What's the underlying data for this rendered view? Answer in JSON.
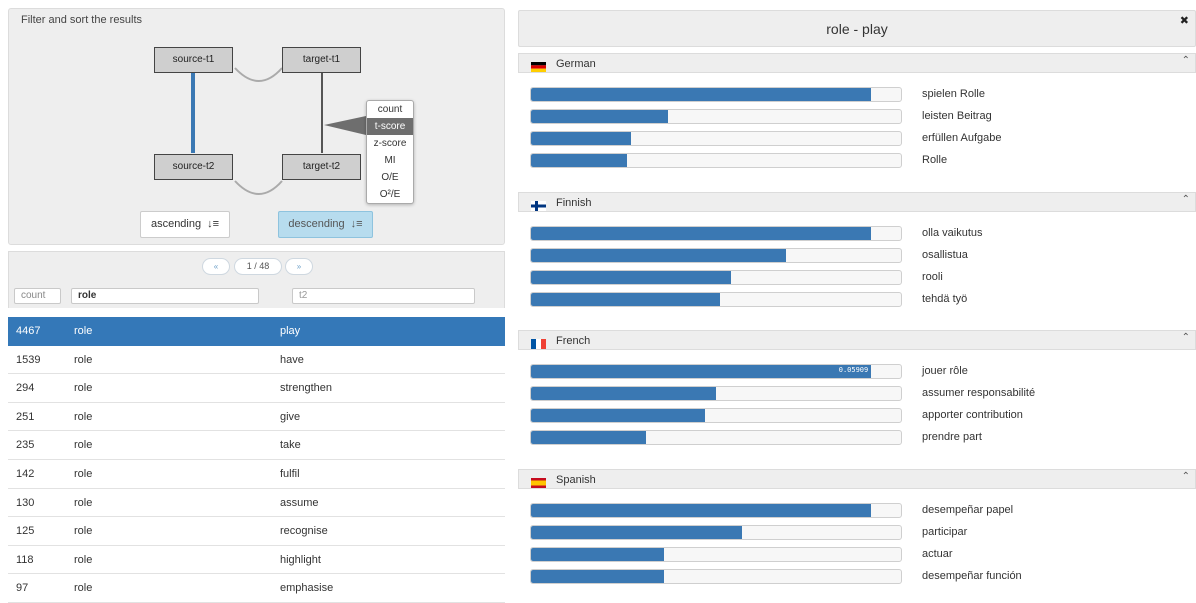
{
  "filter": {
    "title": "Filter and sort the results",
    "nodes": {
      "source_t1": "source-t1",
      "target_t1": "target-t1",
      "source_t2": "source-t2",
      "target_t2": "target-t2"
    },
    "measures": [
      "count",
      "t-score",
      "z-score",
      "MI",
      "O/E",
      "O²/E"
    ],
    "selected_measure": "t-score",
    "sort": {
      "ascending": "ascending",
      "descending": "descending",
      "selected": "descending"
    }
  },
  "pager": {
    "prev": "«",
    "page": "1 / 48",
    "next": "»"
  },
  "column_filters": {
    "count_placeholder": "count",
    "role_value": "role",
    "t2_placeholder": "t2"
  },
  "results": [
    {
      "count": "4467",
      "role": "role",
      "t2": "play",
      "selected": true
    },
    {
      "count": "1539",
      "role": "role",
      "t2": "have"
    },
    {
      "count": "294",
      "role": "role",
      "t2": "strengthen"
    },
    {
      "count": "251",
      "role": "role",
      "t2": "give"
    },
    {
      "count": "235",
      "role": "role",
      "t2": "take"
    },
    {
      "count": "142",
      "role": "role",
      "t2": "fulfil"
    },
    {
      "count": "130",
      "role": "role",
      "t2": "assume"
    },
    {
      "count": "125",
      "role": "role",
      "t2": "recognise"
    },
    {
      "count": "118",
      "role": "role",
      "t2": "highlight"
    },
    {
      "count": "97",
      "role": "role",
      "t2": "emphasise"
    }
  ],
  "detail": {
    "title": "role - play",
    "close": "✖",
    "collapse_icon": "⌃",
    "languages": [
      {
        "name": "German",
        "flag": "de",
        "items": [
          {
            "label": "spielen Rolle",
            "value": 0.92
          },
          {
            "label": "leisten Beitrag",
            "value": 0.37
          },
          {
            "label": "erfüllen Aufgabe",
            "value": 0.27
          },
          {
            "label": "Rolle",
            "value": 0.26
          }
        ]
      },
      {
        "name": "Finnish",
        "flag": "fi",
        "items": [
          {
            "label": "olla vaikutus",
            "value": 0.92
          },
          {
            "label": "osallistua",
            "value": 0.69
          },
          {
            "label": "rooli",
            "value": 0.54
          },
          {
            "label": "tehdä työ",
            "value": 0.51
          }
        ]
      },
      {
        "name": "French",
        "flag": "fr",
        "items": [
          {
            "label": "jouer rôle",
            "value": 0.92,
            "tooltip": "0.05909"
          },
          {
            "label": "assumer responsabilité",
            "value": 0.5
          },
          {
            "label": "apporter contribution",
            "value": 0.47
          },
          {
            "label": "prendre part",
            "value": 0.31
          }
        ]
      },
      {
        "name": "Spanish",
        "flag": "es",
        "items": [
          {
            "label": "desempeñar papel",
            "value": 0.92
          },
          {
            "label": "participar",
            "value": 0.57
          },
          {
            "label": "actuar",
            "value": 0.36
          },
          {
            "label": "desempeñar función",
            "value": 0.36
          }
        ]
      }
    ]
  },
  "colors": {
    "selected_row": "#3478b8",
    "bar_fill": "#3a78b3",
    "sort_active": "#b7dcee"
  }
}
